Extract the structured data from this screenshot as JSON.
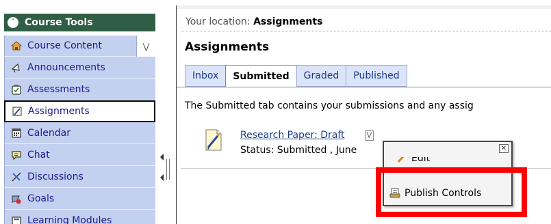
{
  "sidebar": {
    "header_title": "Course Tools",
    "items": [
      {
        "label": "Course Content",
        "icon": "home-icon"
      },
      {
        "label": "Announcements",
        "icon": "megaphone-icon"
      },
      {
        "label": "Assessments",
        "icon": "assessment-icon"
      },
      {
        "label": "Assignments",
        "icon": "assignment-icon"
      },
      {
        "label": "Calendar",
        "icon": "calendar-icon"
      },
      {
        "label": "Chat",
        "icon": "chat-bubble-icon"
      },
      {
        "label": "Discussions",
        "icon": "discussion-icon"
      },
      {
        "label": "Goals",
        "icon": "goals-icon"
      },
      {
        "label": "Learning Modules",
        "icon": "learning-modules-icon"
      }
    ]
  },
  "location": {
    "prefix": "Your location:",
    "current": "Assignments"
  },
  "page": {
    "title": "Assignments",
    "description": "The Submitted tab contains your submissions and any assig"
  },
  "tabs": [
    {
      "label": "Inbox"
    },
    {
      "label": "Submitted"
    },
    {
      "label": "Graded"
    },
    {
      "label": "Published"
    }
  ],
  "assignment": {
    "title": "Research Paper: Draft",
    "status": "Status: Submitted , June"
  },
  "context_menu": {
    "edit_label": "Edit",
    "publish_label": "Publish Controls"
  },
  "colors": {
    "sidebar_header": "#2f5e45",
    "sidebar_item_bg": "#c4d0ef",
    "link": "#1a3a8c",
    "highlight": "#ff0000"
  }
}
